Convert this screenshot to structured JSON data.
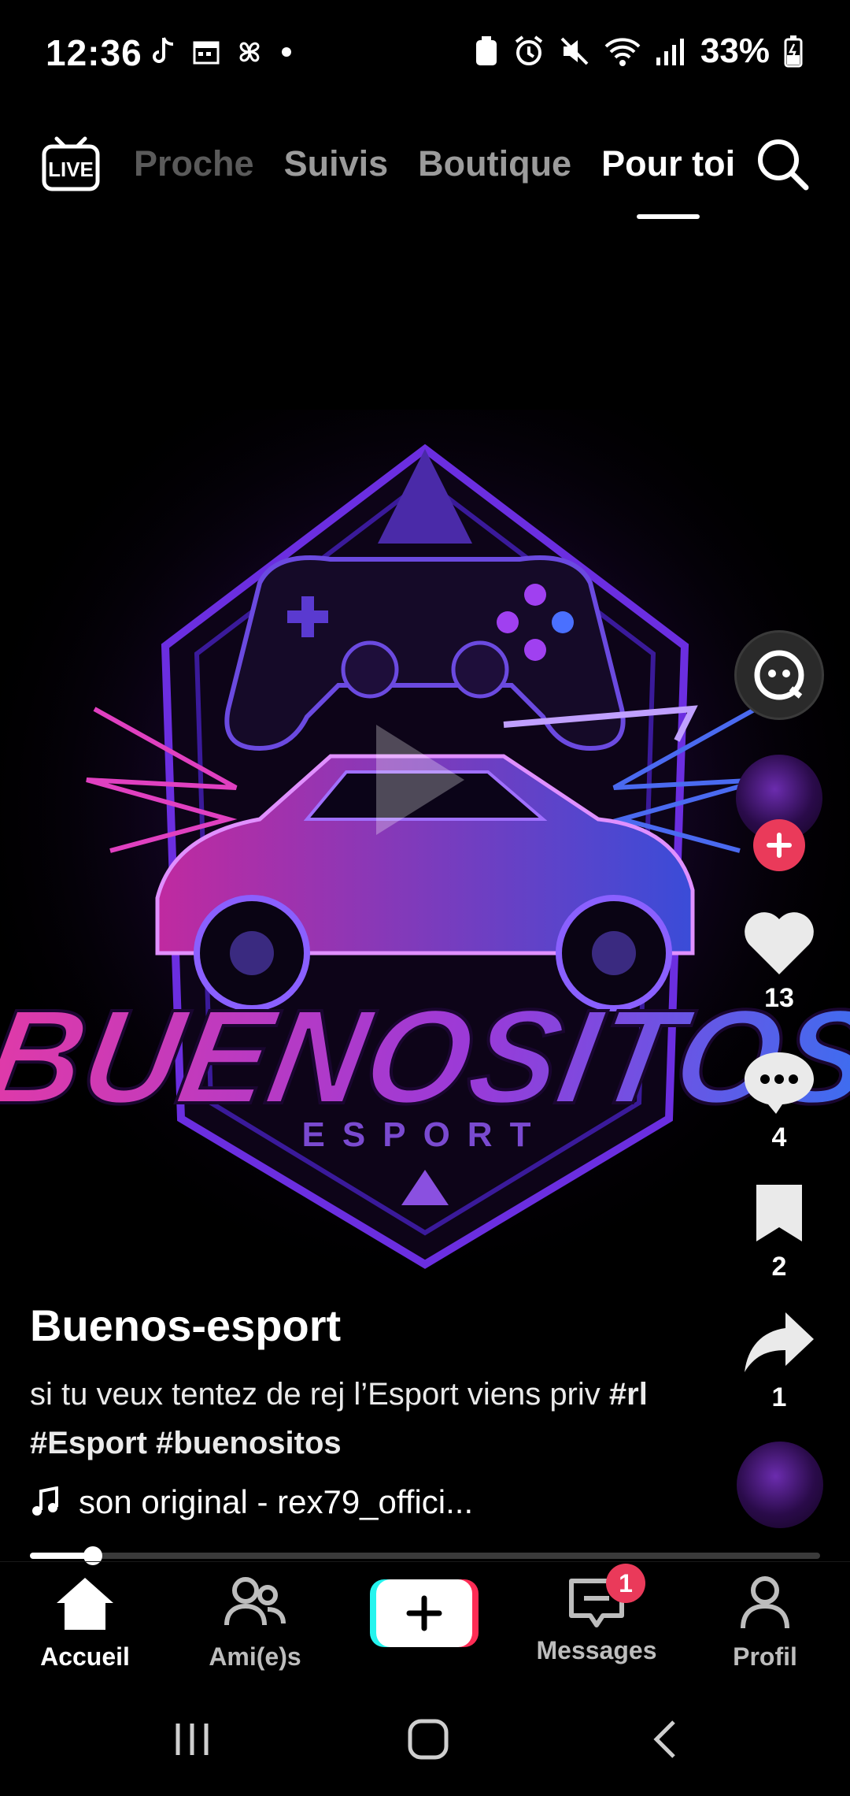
{
  "status_bar": {
    "time": "12:36",
    "battery": "33%"
  },
  "top_nav": {
    "tabs": [
      {
        "label": "Proche"
      },
      {
        "label": "Suivis"
      },
      {
        "label": "Boutique"
      },
      {
        "label": "Pour toi"
      }
    ],
    "active_tab": "Pour toi"
  },
  "artwork": {
    "title": "BUENOSITOS",
    "subtitle": "ESPORT"
  },
  "actions": {
    "likes": "13",
    "comments": "4",
    "saves": "2",
    "shares": "1"
  },
  "post": {
    "author": "Buenos-esport",
    "description": "si tu veux tentez de rej l’Esport viens priv ",
    "hashtags": "#rl #Esport #buenositos",
    "music": "son original - rex79_offici..."
  },
  "playback": {
    "progress": 0.08
  },
  "bottom_nav": {
    "items": [
      {
        "label": "Accueil"
      },
      {
        "label": "Ami(e)s"
      },
      {
        "label": "Messages"
      },
      {
        "label": "Profil"
      }
    ],
    "messages_badge": "1"
  },
  "colors": {
    "accent": "#ea3a5a",
    "background": "#000000"
  }
}
